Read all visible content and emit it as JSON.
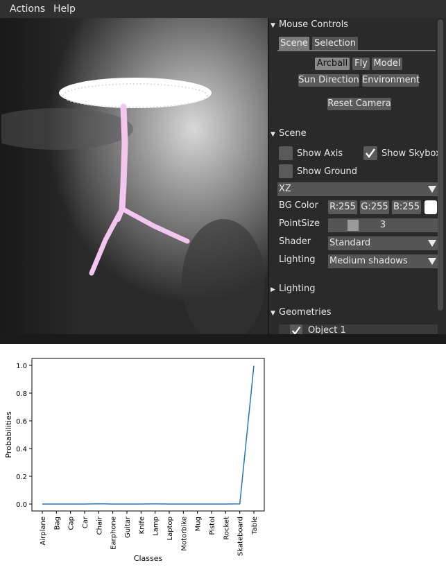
{
  "menu": {
    "items": [
      "Actions",
      "Help"
    ]
  },
  "panel": {
    "mouse_controls": {
      "header": "Mouse Controls",
      "tabs": [
        "Scene",
        "Selection"
      ],
      "modes": [
        "Arcball",
        "Fly",
        "Model"
      ],
      "modes2": [
        "Sun Direction",
        "Environment"
      ],
      "reset": "Reset Camera"
    },
    "scene": {
      "header": "Scene",
      "show_axis": "Show Axis",
      "show_skybox": "Show Skybox",
      "show_ground": "Show Ground",
      "plane": "XZ",
      "bg_label": "BG Color",
      "bg_r": "R:255",
      "bg_g": "G:255",
      "bg_b": "B:255",
      "pointsize_label": "PointSize",
      "pointsize_value": "3",
      "pointsize_fraction": 0.2,
      "shader_label": "Shader",
      "shader_value": "Standard",
      "lighting_label": "Lighting",
      "lighting_value": "Medium shadows"
    },
    "lighting": {
      "header": "Lighting"
    },
    "geometries": {
      "header": "Geometries",
      "object": "Object 1"
    }
  },
  "chart_data": {
    "type": "line",
    "categories": [
      "Airplane",
      "Bag",
      "Cap",
      "Car",
      "Chair",
      "Earphone",
      "Guitar",
      "Knife",
      "Lamp",
      "Laptop",
      "Motorbike",
      "Mug",
      "Pistol",
      "Rocket",
      "Skateboard",
      "Table"
    ],
    "values": [
      0.0,
      0.0,
      0.0,
      0.0,
      0.002,
      0.0,
      0.0,
      0.0,
      0.001,
      0.0,
      0.0,
      0.0,
      0.0,
      0.0,
      0.001,
      0.997
    ],
    "xlabel": "Classes",
    "ylabel": "Probabilities",
    "ylim": [
      -0.05,
      1.05
    ],
    "yticks": [
      "0.0",
      "0.2",
      "0.4",
      "0.6",
      "0.8",
      "1.0"
    ],
    "grid": false,
    "line_color": "#1f77b4"
  }
}
